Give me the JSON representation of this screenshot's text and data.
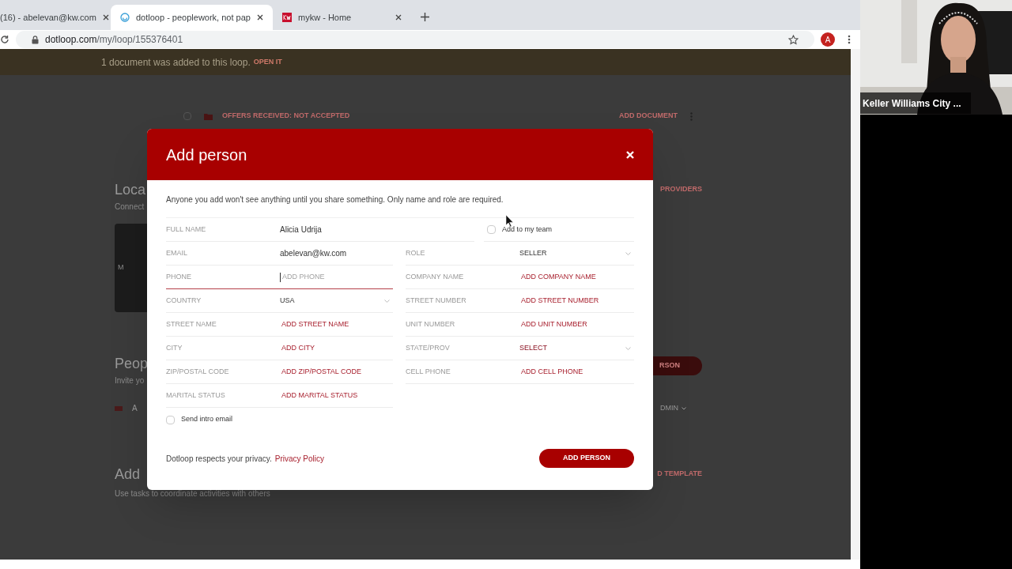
{
  "browser": {
    "tabs": [
      {
        "title": "(16) - abelevan@kw.com",
        "selected": false
      },
      {
        "title": "dotloop - peoplework, not pap",
        "selected": true
      },
      {
        "title": "mykw - Home",
        "selected": false
      }
    ],
    "url_host": "dotloop.com",
    "url_path": "/my/loop/155376401",
    "profile_initial": "A"
  },
  "page": {
    "banner": {
      "text": "1 document was added to this loop.",
      "action": "OPEN IT"
    },
    "document_row": {
      "title": "OFFERS RECEIVED: NOT ACCEPTED",
      "action": "ADD DOCUMENT",
      "checked": false
    },
    "sections": [
      {
        "heading": "Loca",
        "subheading": "Connect",
        "action": "PROVIDERS",
        "kind": "tiles",
        "tile_text": "M"
      },
      {
        "heading": "Peop",
        "subheading": "Invite yo",
        "action": "RSON",
        "kind": "people",
        "row_text": "A",
        "row_action": "DMIN"
      },
      {
        "heading": "Add",
        "subheading": "Use tasks to coordinate activities with others",
        "action": "D TEMPLATE",
        "kind": "tasks"
      }
    ]
  },
  "modal": {
    "title": "Add person",
    "intro": "Anyone you add won't see anything until you share something. Only name and role are required.",
    "name_field": {
      "label": "FULL NAME",
      "kind": "value",
      "value": "Alicia Udrija"
    },
    "team_checkbox": {
      "label": "Add to my team",
      "checked": false
    },
    "left_fields": [
      {
        "label": "EMAIL",
        "kind": "value",
        "value": "abelevan@kw.com"
      },
      {
        "label": "PHONE",
        "kind": "input",
        "placeholder": "ADD PHONE",
        "focused": true
      },
      {
        "label": "COUNTRY",
        "kind": "select",
        "value": "USA"
      },
      {
        "label": "STREET NAME",
        "kind": "action",
        "value": "ADD STREET NAME"
      },
      {
        "label": "CITY",
        "kind": "action",
        "value": "ADD CITY"
      },
      {
        "label": "ZIP/POSTAL CODE",
        "kind": "action",
        "value": "ADD ZIP/POSTAL CODE"
      },
      {
        "label": "MARITAL STATUS",
        "kind": "action",
        "value": "ADD MARITAL STATUS"
      }
    ],
    "right_fields": [
      {
        "label": "ROLE",
        "kind": "select",
        "value": "SELLER"
      },
      {
        "label": "COMPANY NAME",
        "kind": "action",
        "value": "ADD COMPANY NAME"
      },
      {
        "label": "STREET NUMBER",
        "kind": "action",
        "value": "ADD STREET NUMBER"
      },
      {
        "label": "UNIT NUMBER",
        "kind": "action",
        "value": "ADD UNIT NUMBER"
      },
      {
        "label": "STATE/PROV",
        "kind": "select_empty",
        "value": "SELECT"
      },
      {
        "label": "CELL PHONE",
        "kind": "action",
        "value": "ADD CELL PHONE"
      }
    ],
    "intro_email": {
      "label": "Send intro email",
      "checked": false
    },
    "privacy": {
      "text": "Dotloop respects your privacy.",
      "link": "Privacy Policy"
    },
    "submit": "ADD PERSON"
  },
  "video": {
    "caption": "Keller Williams City ..."
  }
}
